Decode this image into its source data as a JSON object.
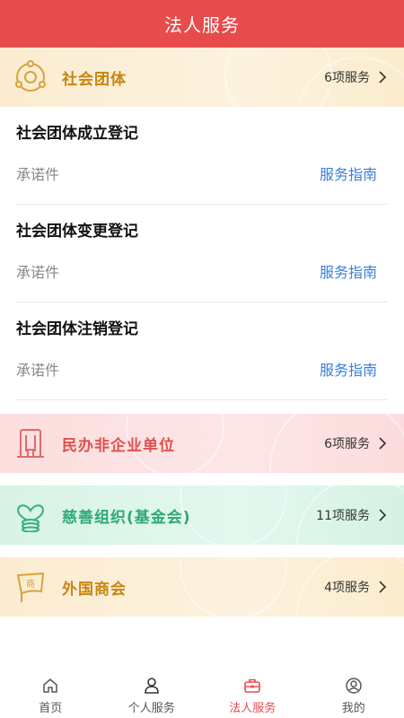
{
  "header": {
    "title": "法人服务"
  },
  "categories": [
    {
      "name": "社会团体",
      "count": "6项服务",
      "icon": "network-circle-icon",
      "color": "#c8860f"
    },
    {
      "name": "民办非企业单位",
      "count": "6项服务",
      "icon": "building-icon",
      "color": "#e05050"
    },
    {
      "name": "慈善组织(基金会)",
      "count": "11项服务",
      "icon": "heart-coins-icon",
      "color": "#2eaa73"
    },
    {
      "name": "外国商会",
      "count": "4项服务",
      "icon": "chamber-flag-icon",
      "color": "#c8860f"
    }
  ],
  "services": [
    {
      "title": "社会团体成立登记",
      "type": "承诺件",
      "guide": "服务指南"
    },
    {
      "title": "社会团体变更登记",
      "type": "承诺件",
      "guide": "服务指南"
    },
    {
      "title": "社会团体注销登记",
      "type": "承诺件",
      "guide": "服务指南"
    }
  ],
  "tabbar": {
    "items": [
      {
        "label": "首页",
        "icon": "home-icon"
      },
      {
        "label": "个人服务",
        "icon": "person-icon"
      },
      {
        "label": "法人服务",
        "icon": "briefcase-icon",
        "active": true
      },
      {
        "label": "我的",
        "icon": "user-circle-icon"
      }
    ],
    "active_color": "#e84b4b"
  }
}
